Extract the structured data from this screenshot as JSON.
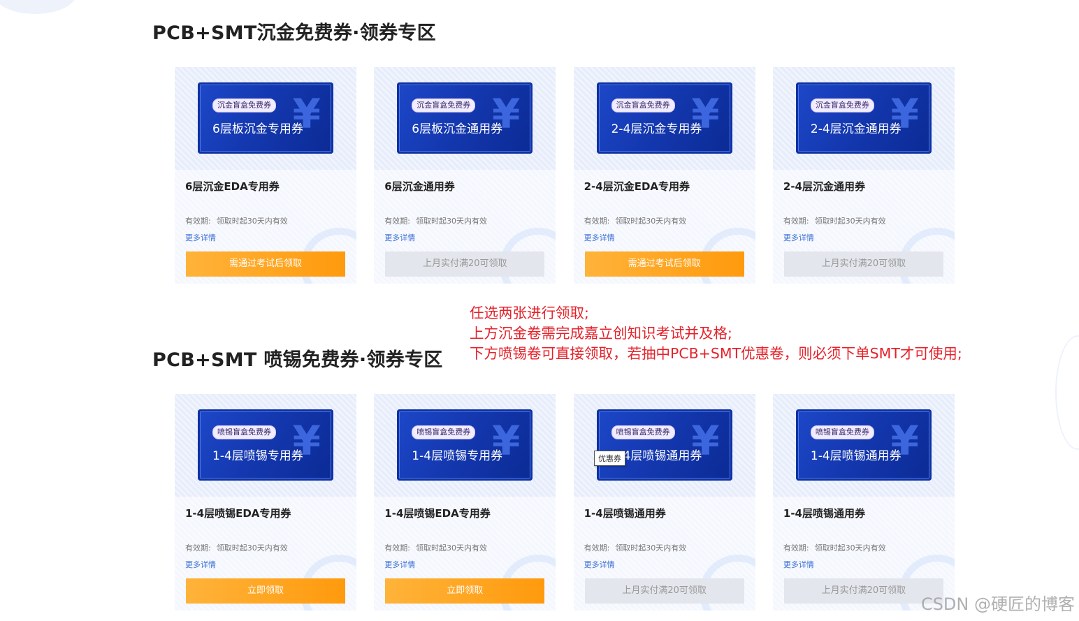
{
  "section1": {
    "title": "PCB+SMT沉金免费券·领券专区",
    "cards": [
      {
        "badge": "沉金盲盒免费券",
        "ticket_title": "6层板沉金专用券",
        "name": "6层沉金EDA专用券",
        "validity_label": "有效期:",
        "validity_value": "领取时起30天内有效",
        "more": "更多详情",
        "button": "需通过考试后领取",
        "button_style": "orange"
      },
      {
        "badge": "沉金盲盒免费券",
        "ticket_title": "6层板沉金通用券",
        "name": "6层沉金通用券",
        "validity_label": "有效期:",
        "validity_value": "领取时起30天内有效",
        "more": "更多详情",
        "button": "上月实付满20可领取",
        "button_style": "gray"
      },
      {
        "badge": "沉金盲盒免费券",
        "ticket_title": "2-4层沉金专用券",
        "name": "2-4层沉金EDA专用券",
        "validity_label": "有效期:",
        "validity_value": "领取时起30天内有效",
        "more": "更多详情",
        "button": "需通过考试后领取",
        "button_style": "orange"
      },
      {
        "badge": "沉金盲盒免费券",
        "ticket_title": "2-4层沉金通用券",
        "name": "2-4层沉金通用券",
        "validity_label": "有效期:",
        "validity_value": "领取时起30天内有效",
        "more": "更多详情",
        "button": "上月实付满20可领取",
        "button_style": "gray"
      }
    ]
  },
  "section2": {
    "title": "PCB+SMT 喷锡免费券·领券专区",
    "cards": [
      {
        "badge": "喷锡盲盒免费券",
        "ticket_title": "1-4层喷锡专用券",
        "name": "1-4层喷锡EDA专用券",
        "validity_label": "有效期:",
        "validity_value": "领取时起30天内有效",
        "more": "更多详情",
        "button": "立即领取",
        "button_style": "orange"
      },
      {
        "badge": "喷锡盲盒免费券",
        "ticket_title": "1-4层喷锡专用券",
        "name": "1-4层喷锡EDA专用券",
        "validity_label": "有效期:",
        "validity_value": "领取时起30天内有效",
        "more": "更多详情",
        "button": "立即领取",
        "button_style": "orange"
      },
      {
        "badge": "喷锡盲盒免费券",
        "ticket_title": "1-4层喷锡通用券",
        "name": "1-4层喷锡通用券",
        "validity_label": "有效期:",
        "validity_value": "领取时起30天内有效",
        "more": "更多详情",
        "button": "上月实付满20可领取",
        "button_style": "gray"
      },
      {
        "badge": "喷锡盲盒免费券",
        "ticket_title": "1-4层喷锡通用券",
        "name": "1-4层喷锡通用券",
        "validity_label": "有效期:",
        "validity_value": "领取时起30天内有效",
        "more": "更多详情",
        "button": "上月实付满20可领取",
        "button_style": "gray"
      }
    ]
  },
  "ticket_symbol": "¥",
  "annotation": {
    "lines": [
      "任选两张进行领取;",
      "上方沉金卷需完成嘉立创知识考试并及格;",
      "下方喷锡卷可直接领取，若抽中PCB+SMT优惠卷，则必须下单SMT才可使用;"
    ],
    "color": "#e5212a"
  },
  "tooltip": "优惠券",
  "watermark": "CSDN @硬匠的博客",
  "colors": {
    "accent_orange": "#ff9a0d",
    "ticket_blue": "#1438b0",
    "link_blue": "#3b6fd6",
    "disabled_gray": "#e3e6ec"
  }
}
